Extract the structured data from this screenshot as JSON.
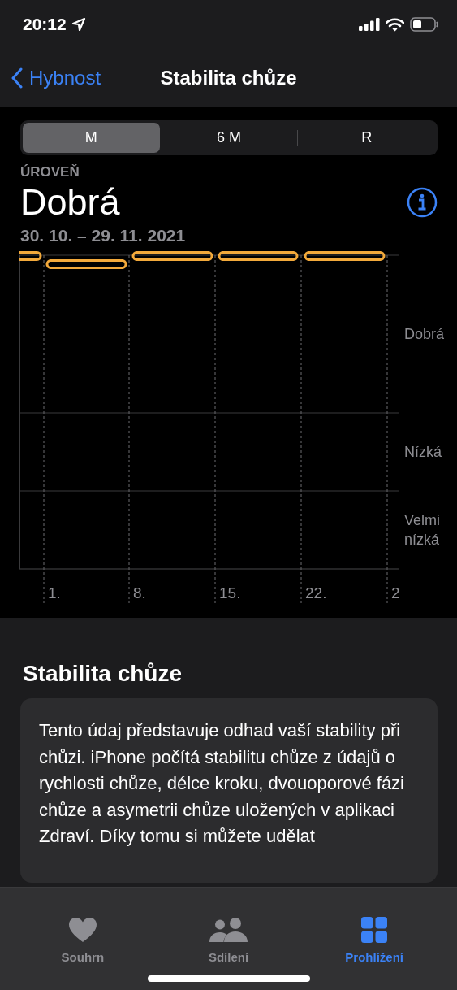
{
  "status_bar": {
    "time": "20:12"
  },
  "nav": {
    "back_label": "Hybnost",
    "title": "Stabilita chůze"
  },
  "periods": [
    {
      "label": "M",
      "selected": true
    },
    {
      "label": "6 M",
      "selected": false
    },
    {
      "label": "R",
      "selected": false
    }
  ],
  "summary": {
    "caption": "ÚROVEŇ",
    "value": "Dobrá",
    "date_range": "30. 10. – 29. 11. 2021"
  },
  "chart": {
    "y_labels": [
      "Dobrá",
      "Nízká",
      "Velmi nízká"
    ],
    "x_labels": [
      "1.",
      "8.",
      "15.",
      "22.",
      "2"
    ]
  },
  "about": {
    "heading": "Stabilita chůze",
    "text": "Tento údaj představuje odhad vaší stability při chůzi. iPhone počítá stabilitu chůze z údajů o rychlosti chůze, délce kroku, dvouoporové fázi chůze a asymetrii chůze uložených v aplikaci Zdraví. Díky tomu si můžete udělat"
  },
  "tab_bar": [
    {
      "label": "Souhrn",
      "selected": false
    },
    {
      "label": "Sdílení",
      "selected": false
    },
    {
      "label": "Prohlížení",
      "selected": true
    }
  ]
}
